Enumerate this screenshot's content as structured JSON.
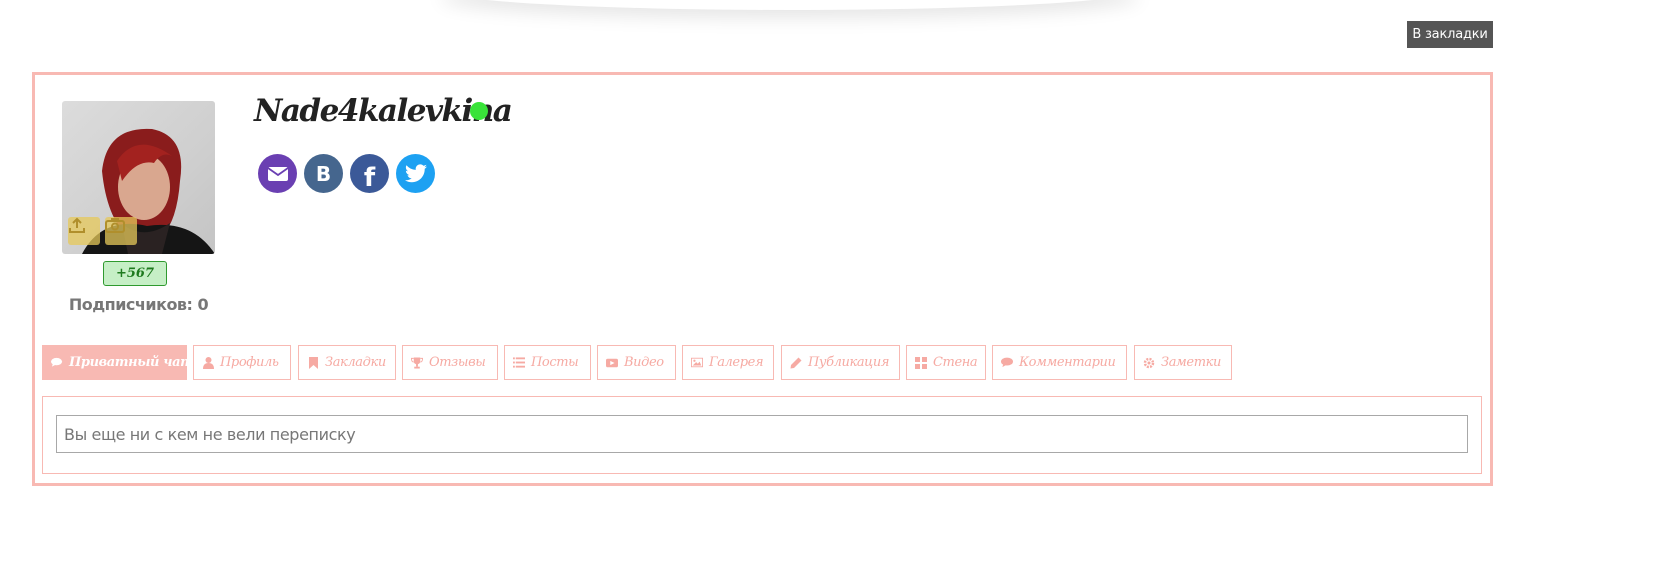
{
  "bookmark_button": "В закладки",
  "profile": {
    "username": "Nade4kalevkina",
    "online": true,
    "rating": "+567",
    "followers_label": "Подписчиков: 0",
    "avatar_actions": [
      "upload-icon",
      "camera-icon"
    ],
    "social": [
      {
        "name": "mail-icon",
        "glyph": "✉",
        "color": "#6a3fb2"
      },
      {
        "name": "vk-icon",
        "glyph": "B",
        "color": "#45668e"
      },
      {
        "name": "facebook-icon",
        "glyph": "f",
        "color": "#3b5998"
      },
      {
        "name": "twitter-icon",
        "glyph": "t",
        "color": "#1da1f2"
      }
    ]
  },
  "tabs": [
    {
      "label": "Приватный чат",
      "icon": "chat-icon",
      "active": true
    },
    {
      "label": "Профиль",
      "icon": "user-icon"
    },
    {
      "label": "Закладки",
      "icon": "bookmark-icon"
    },
    {
      "label": "Отзывы",
      "icon": "trophy-icon"
    },
    {
      "label": "Посты",
      "icon": "list-icon"
    },
    {
      "label": "Видео",
      "icon": "video-icon"
    },
    {
      "label": "Галерея",
      "icon": "image-icon"
    },
    {
      "label": "Публикация",
      "icon": "pencil-icon"
    },
    {
      "label": "Стена",
      "icon": "grid-icon"
    },
    {
      "label": "Комментарии",
      "icon": "comment-icon"
    },
    {
      "label": "Заметки",
      "icon": "gear-icon"
    }
  ],
  "chat": {
    "empty_message": "Вы еще ни с кем не вели переписку"
  },
  "colors": {
    "accent": "#f8b9b3",
    "tab_text": "#f6aaa3",
    "online": "#39e339",
    "rating_bg": "#c6efc6",
    "rating_text": "#1f7a1f"
  }
}
